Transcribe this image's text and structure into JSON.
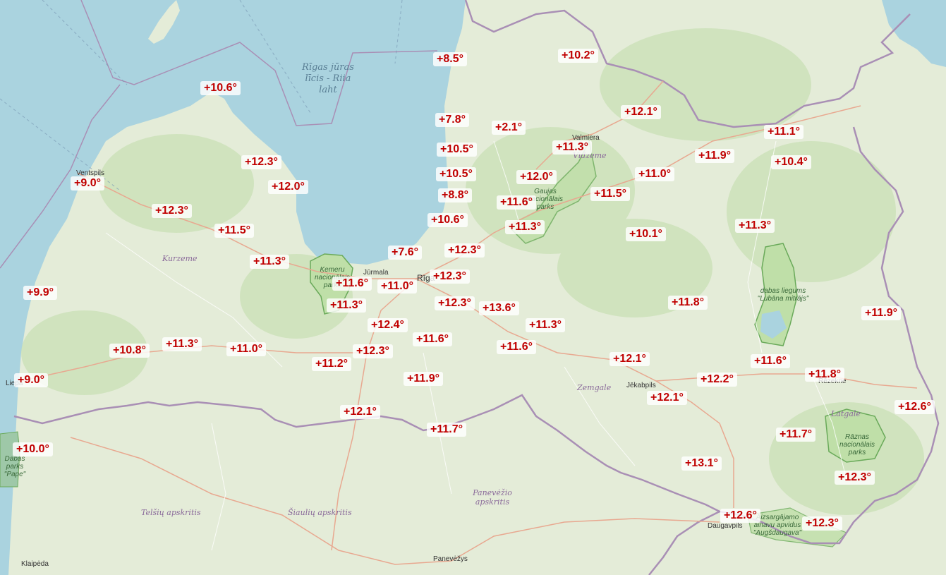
{
  "map": {
    "sea_label": [
      "Rīgas jūras",
      "līcis - Riia",
      "laht"
    ],
    "colors": {
      "sea": "#aad3df",
      "land": "#e4ecd8",
      "forest": "#c8e0b4",
      "border": "#a98fb5",
      "road": "#f0c0a0",
      "temperature": "#c00000"
    },
    "temperatures": [
      "+8.5°",
      "+10.2°",
      "+10.6°",
      "+12.1°",
      "+7.8°",
      "+2.1°",
      "+11.1°",
      "+11.3°",
      "+10.5°",
      "+11.9°",
      "+12.3°",
      "+10.4°",
      "+10.5°",
      "+12.0°",
      "+11.0°",
      "+9.0°",
      "+12.0°",
      "+8.8°",
      "+11.5°",
      "+12.3°",
      "+11.6°",
      "+11.5°",
      "+10.6°",
      "+11.3°",
      "+11.3°",
      "+10.1°",
      "+12.3°",
      "+7.6°",
      "+11.3°",
      "+12.3°",
      "+11.6°",
      "+11.0°",
      "+9.9°",
      "+11.3°",
      "+12.3°",
      "+13.6°",
      "+11.8°",
      "+11.9°",
      "+12.4°",
      "+11.3°",
      "+11.3°",
      "+11.6°",
      "+10.8°",
      "+11.0°",
      "+11.6°",
      "+12.3°",
      "+12.1°",
      "+11.2°",
      "+11.6°",
      "+9.0°",
      "+11.8°",
      "+11.9°",
      "+12.2°",
      "+12.1°",
      "+12.6°",
      "+12.1°",
      "+11.7°",
      "+11.7°",
      "+10.0°",
      "+13.1°",
      "+12.3°",
      "+12.6°",
      "+12.3°"
    ],
    "places": [
      "Ventspils",
      "Valmiera",
      "Jūrmala",
      "Rīga",
      "Liepā",
      "Jēkabpils",
      "Rēzekne",
      "Daugavpils",
      "Panevėžys",
      "Klaipėda"
    ],
    "regions": [
      "Kurzeme",
      "Vidzeme",
      "Zemgale",
      "Latgale",
      "Panevėžio apskritis",
      "Telšių apskritis",
      "Šiaulių apskritis"
    ],
    "parks": [
      "Ķemeru nacionālais parks",
      "Gaujas nacionālais parks",
      "dabas liegums \"Lubāna mitrājs\"",
      "Rāznas nacionālais parks",
      "Aizsargājamo ainavu apvidus \"Augšdaugava\"",
      "Dabas parks \"Pape\""
    ]
  }
}
